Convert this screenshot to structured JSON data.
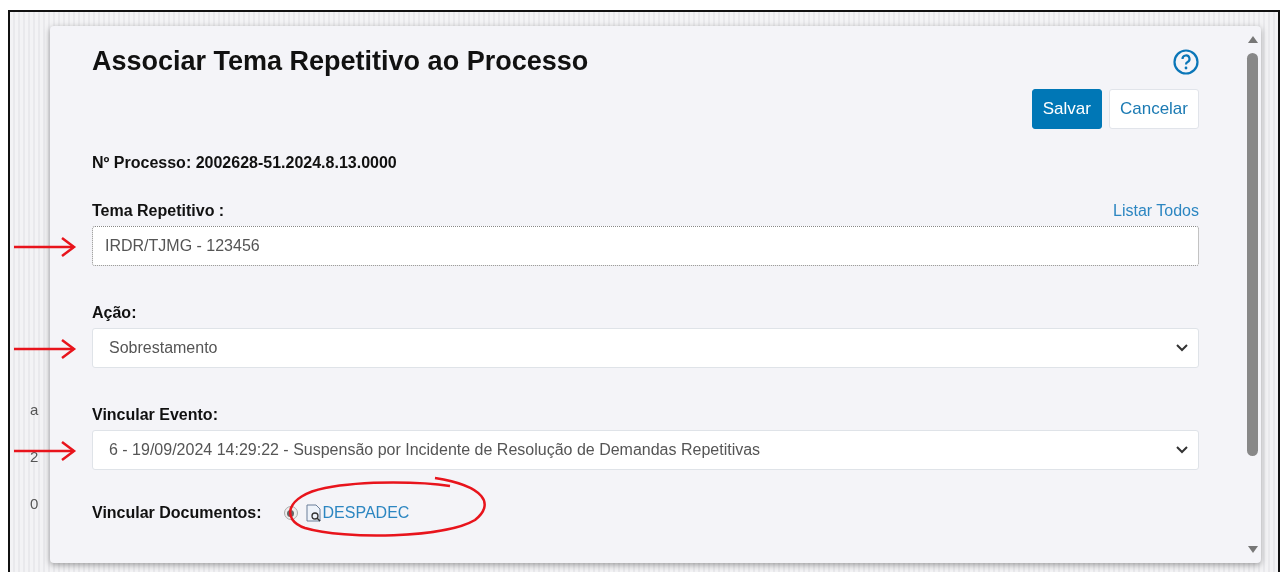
{
  "background_fragments": [
    {
      "text": "a"
    },
    {
      "text": "2"
    },
    {
      "text": "0"
    }
  ],
  "dialog": {
    "title": "Associar Tema Repetitivo ao Processo",
    "buttons": [
      {
        "label": "Salvar",
        "kind": "primary"
      },
      {
        "label": "Cancelar",
        "kind": "secondary"
      }
    ],
    "process_number": "Nº Processo: 2002628-51.2024.8.13.0000",
    "fields": [
      {
        "label": "Tema Repetitivo :",
        "kind": "text",
        "value": "IRDR/TJMG - 123456",
        "link": "Listar Todos",
        "highlighted": true
      },
      {
        "label": "Ação:",
        "kind": "select",
        "value": "Sobrestamento",
        "highlighted": true
      },
      {
        "label": "Vincular Evento:",
        "kind": "select",
        "value": "6 - 19/09/2024 14:29:22 - Suspensão por Incidente de Resolução de Demandas Repetitivas",
        "highlighted": true
      }
    ],
    "documents": {
      "label": "Vincular Documentos:",
      "items": [
        {
          "name": "DESPADEC",
          "selected": true
        }
      ],
      "circled": true
    }
  }
}
